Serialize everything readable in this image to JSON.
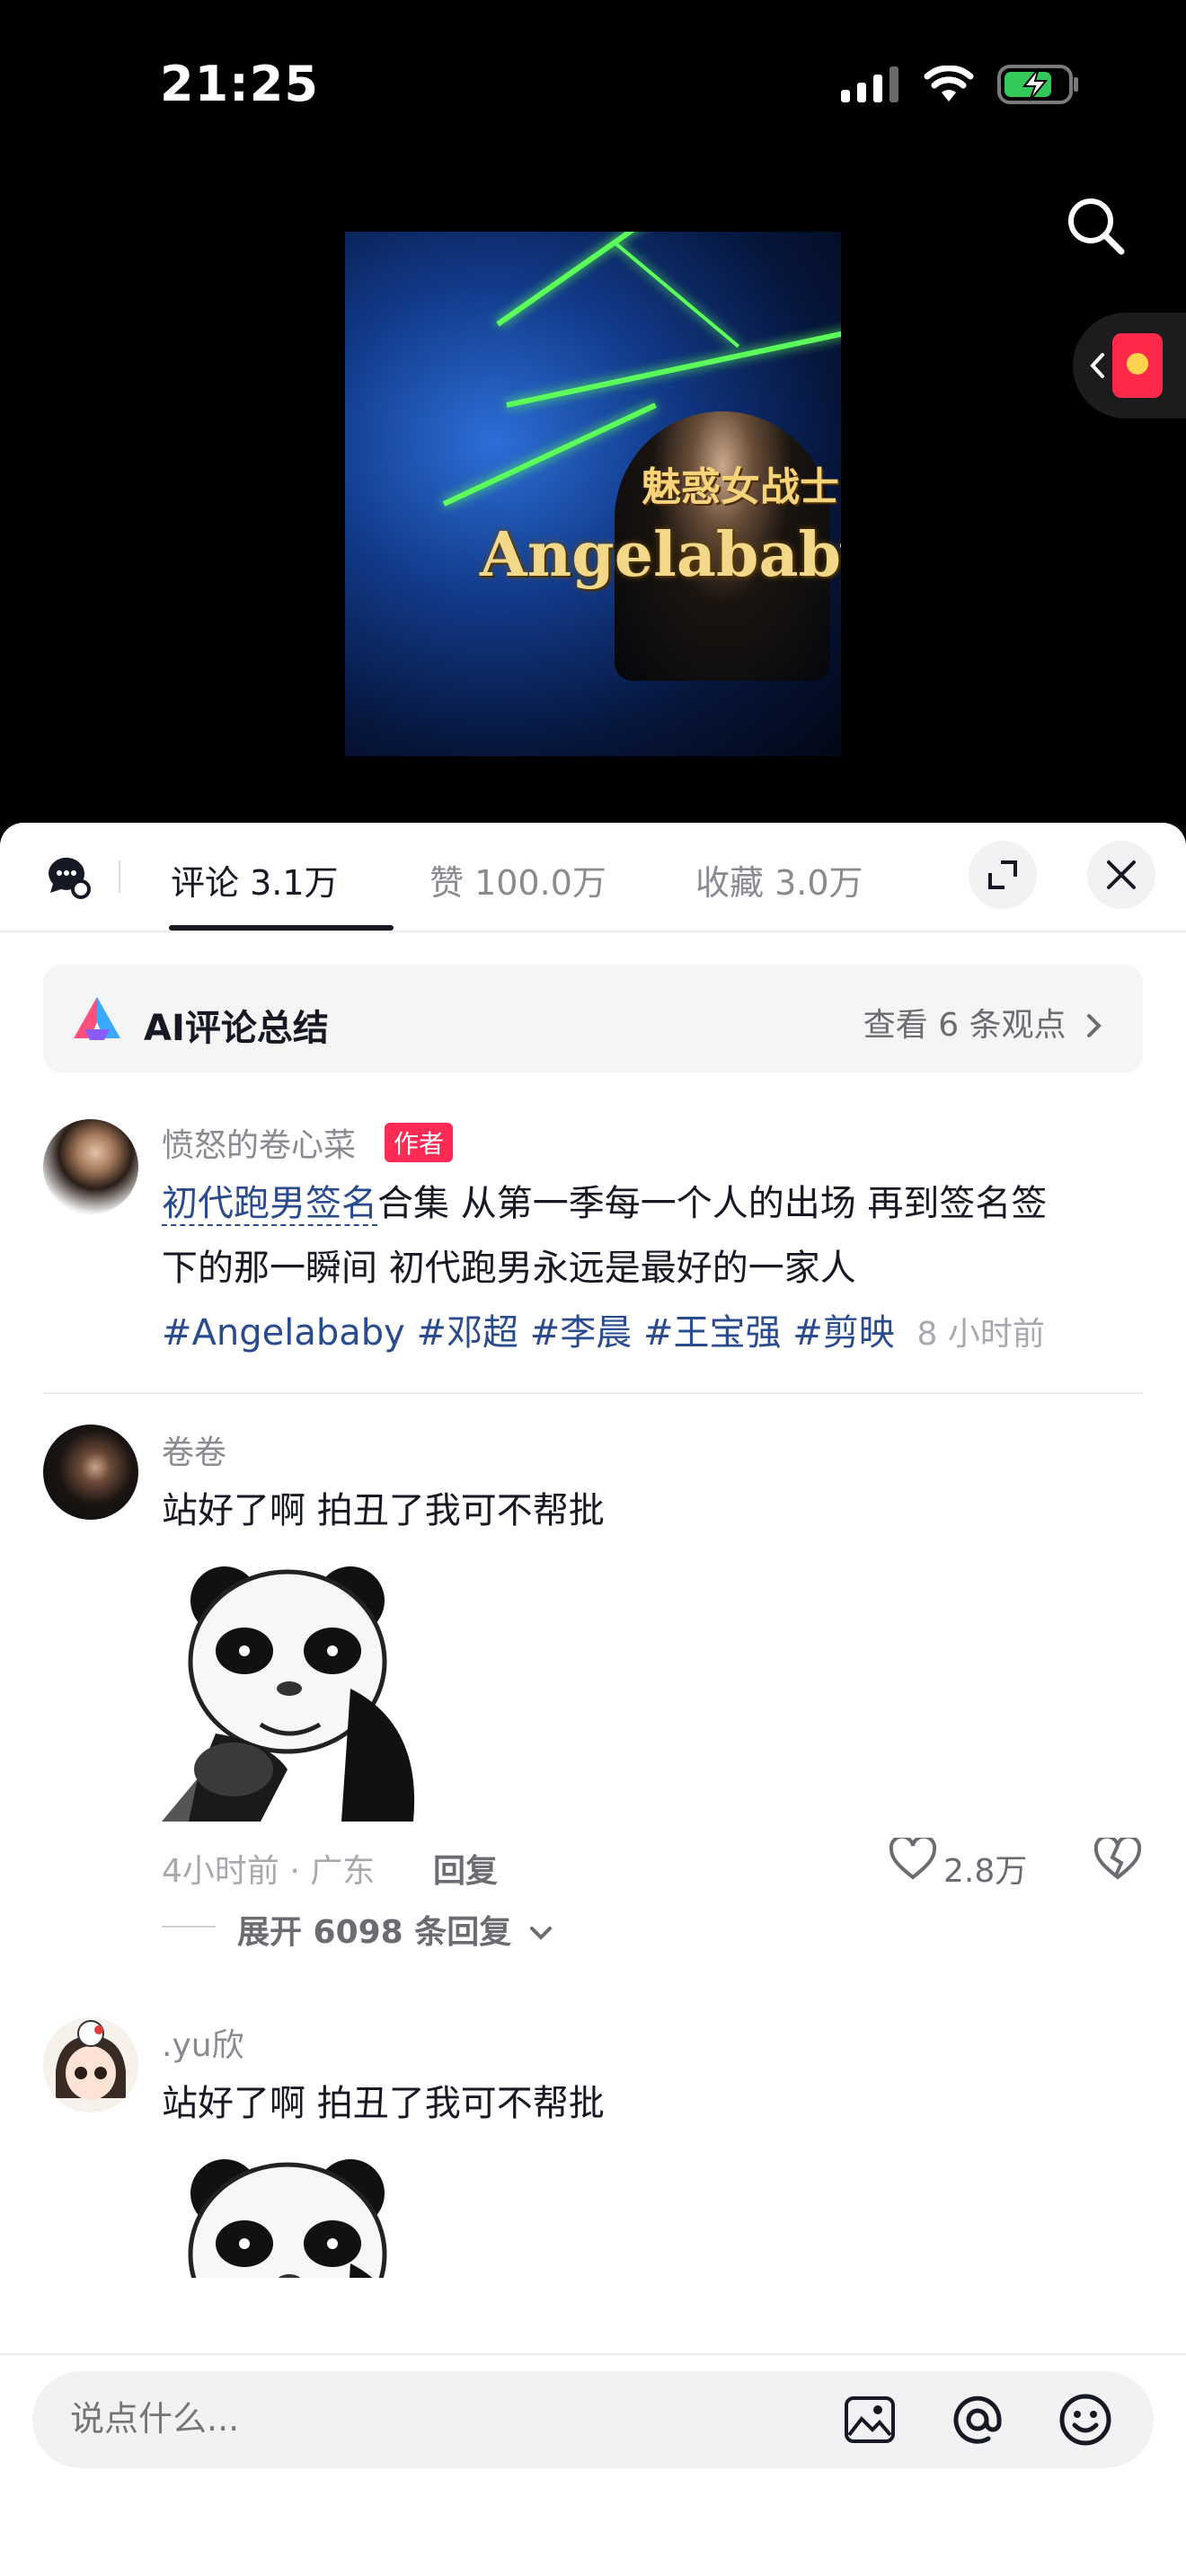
{
  "status": {
    "time": "21:25"
  },
  "video": {
    "caption": "Angelababy",
    "subtitle": "魅惑女战士"
  },
  "tabs": {
    "comments": "评论 3.1万",
    "likes": "赞 100.0万",
    "favorites": "收藏 3.0万"
  },
  "ai_summary": {
    "title": "AI评论总结",
    "more": "查看 6 条观点"
  },
  "post": {
    "author": "愤怒的卷心菜",
    "badge": "作者",
    "link_text": "初代跑男签名",
    "text1": "合集 从第一季每一个人的出场 再到签名签",
    "text2": "下的那一瞬间 初代跑男永远是最好的一家人",
    "hashtags": [
      "#Angelababy",
      "#邓超",
      "#李晨",
      "#王宝强",
      "#剪映"
    ],
    "time": "8 小时前"
  },
  "comments": [
    {
      "user": "卷卷",
      "text": "站好了啊 拍丑了我可不帮批",
      "meta": "4小时前 · 广东",
      "reply": "回复",
      "likes": "2.8万",
      "expand": "展开 6098 条回复"
    },
    {
      "user": ".yu欣",
      "text": "站好了啊 拍丑了我可不帮批"
    }
  ],
  "input": {
    "placeholder": "说点什么..."
  },
  "colors": {
    "accent": "#fe2c55",
    "link": "#2a4b8d",
    "laser": "#5dff5a"
  }
}
